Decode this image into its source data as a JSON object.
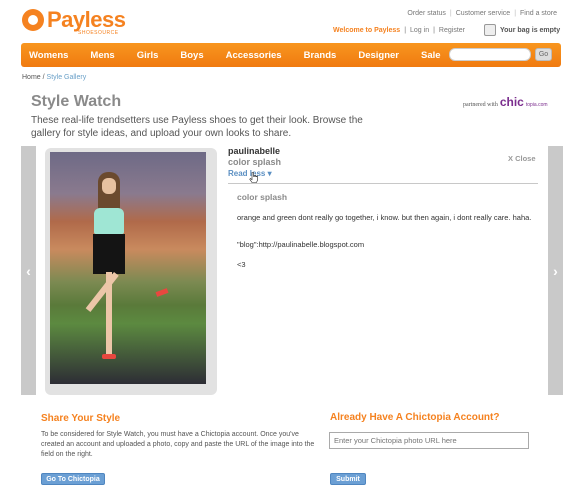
{
  "header": {
    "logo_text": "Payless",
    "logo_sub": "SHOESOURCE",
    "top_links": [
      "Order status",
      "Customer service",
      "Find a store"
    ],
    "welcome": "Welcome to Payless",
    "login": "Log in",
    "register": "Register",
    "bag": "Your bag is empty"
  },
  "nav": {
    "items": [
      "Womens",
      "Mens",
      "Girls",
      "Boys",
      "Accessories",
      "Brands",
      "Designer",
      "Sale"
    ],
    "search_value": "",
    "go_label": "Go"
  },
  "breadcrumb": {
    "home": "Home",
    "separator": " / ",
    "current": "Style Gallery"
  },
  "page": {
    "title": "Style Watch",
    "partner_prefix": "partnered with",
    "partner_brand": "chic",
    "partner_brand_suffix": "topia.com",
    "intro": "These real-life trendsetters use Payless shoes to get their look.  Browse the gallery for style ideas, and upload your own looks to share."
  },
  "look": {
    "username": "paulinabelle",
    "title": "color splash",
    "read_less": "Read less",
    "close": "X Close",
    "detail_title": "color splash",
    "detail_lines": [
      "orange and green dont really go together, i know.  but then again, i dont really care. haha.",
      "\"blog\":http://paulinabelle.blogspot.com",
      "<3"
    ]
  },
  "share": {
    "title": "Share Your Style",
    "text": "To be considered for Style Watch, you must have a Chictopia account. Once you've created an account and uploaded a photo, copy and paste the URL of the image into the field on the right.",
    "button": "Go To Chictopia"
  },
  "chictopia_form": {
    "title": "Already Have A Chictopia Account?",
    "input_placeholder": "Enter your Chictopia photo URL here",
    "submit": "Submit"
  },
  "colors": {
    "brand_orange": "#f58220",
    "link_blue": "#5b8fc2",
    "button_blue": "#6b9fd4"
  }
}
